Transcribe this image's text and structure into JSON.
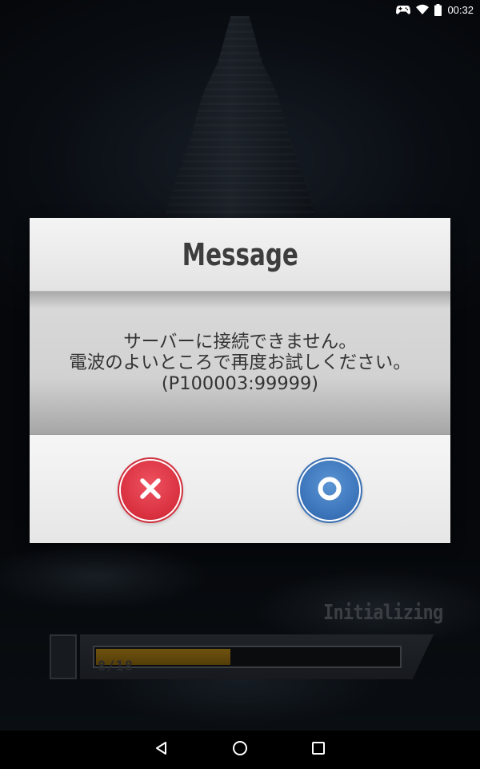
{
  "status_bar": {
    "time": "00:32",
    "icons": [
      "gamepad-icon",
      "wifi-icon",
      "battery-icon"
    ]
  },
  "dialog": {
    "title": "Message",
    "message_lines": [
      "サーバーに接続できません。",
      "電波のよいところで再度お試しください。",
      "(P100003:99999)"
    ],
    "cancel_icon": "close-x-icon",
    "ok_icon": "circle-o-icon",
    "colors": {
      "cancel": "#d8303f",
      "ok": "#3a72b8"
    }
  },
  "loading": {
    "label": "Initializing",
    "count_text": "8/18",
    "progress": 0.444,
    "bar_color": "#c8961d"
  },
  "nav_bar": {
    "icons": [
      "back-icon",
      "home-icon",
      "recent-apps-icon"
    ]
  }
}
